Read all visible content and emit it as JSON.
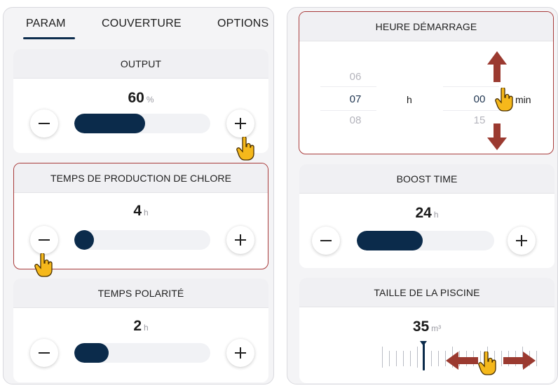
{
  "left_panel": {
    "tabs": [
      {
        "label": "PARAM",
        "active": true
      },
      {
        "label": "COUVERTURE",
        "active": false
      },
      {
        "label": "OPTIONS",
        "active": false
      }
    ],
    "output": {
      "title": "OUTPUT",
      "value": "60",
      "unit": "%",
      "level": 0.52
    },
    "chlore": {
      "title": "TEMPS DE PRODUCTION DE CHLORE",
      "value": "4",
      "unit": "h",
      "level": 0.1
    },
    "polarite": {
      "title": "TEMPS POLARITÉ",
      "value": "2",
      "unit": "h",
      "level": 0.25
    }
  },
  "right_panel": {
    "heure": {
      "title": "HEURE DÉMARRAGE",
      "hours": [
        "06",
        "07",
        "08"
      ],
      "hour_label": "h",
      "minutes": [
        "",
        "00",
        "15"
      ],
      "min_label": "min"
    },
    "boost": {
      "title": "BOOST TIME",
      "value": "24",
      "unit": "h",
      "level": 0.48
    },
    "piscine": {
      "title": "TAILLE DE LA PISCINE",
      "value": "35",
      "unit": "m³"
    }
  },
  "colors": {
    "accent": "#0b2b4b",
    "highlight_border": "#a83a3a",
    "arrow": "#9b3a30",
    "hand": "#f5b81b"
  },
  "icons": {
    "minus": "minus-icon",
    "plus": "plus-icon",
    "hand": "pointing-hand-icon"
  }
}
